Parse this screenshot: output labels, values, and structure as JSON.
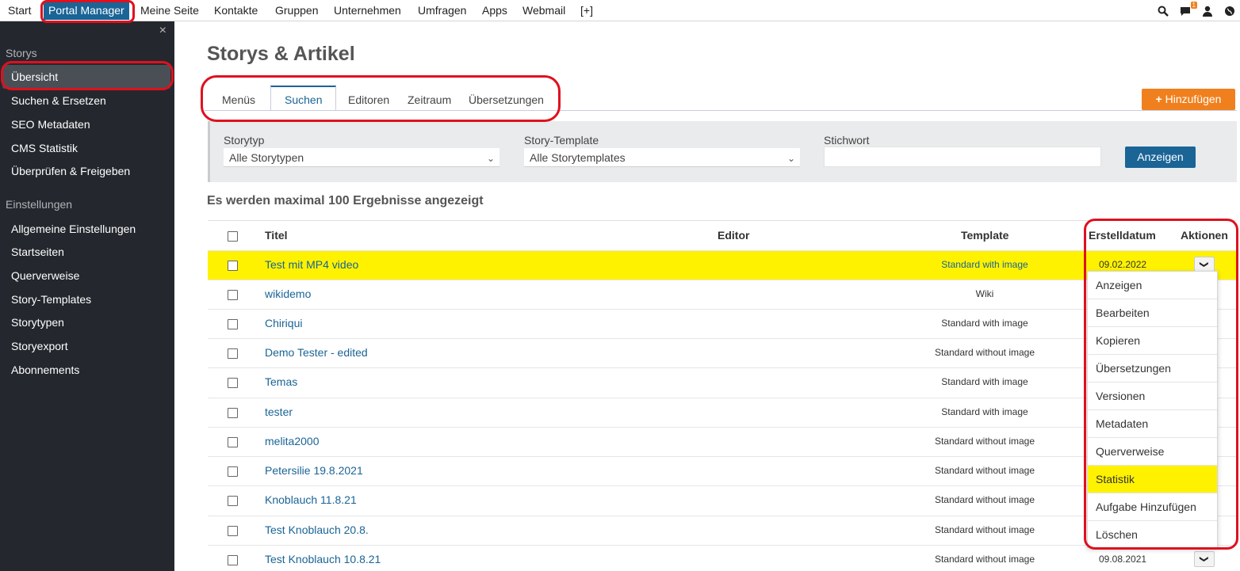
{
  "topnav": {
    "items": [
      "Start",
      "Portal Manager",
      "Meine Seite",
      "Kontakte",
      "Gruppen",
      "Unternehmen",
      "Umfragen",
      "Apps",
      "Webmail",
      "[+]"
    ],
    "active": "Portal Manager",
    "notification_count": "1",
    "icons": [
      "search-icon",
      "chat-icon",
      "user-icon",
      "globe-icon"
    ]
  },
  "sidebar": {
    "close": "×",
    "section1": "Storys",
    "storys": [
      "Übersicht",
      "Suchen & Ersetzen",
      "SEO Metadaten",
      "CMS Statistik",
      "Überprüfen & Freigeben"
    ],
    "section2": "Einstellungen",
    "settings": [
      "Allgemeine Einstellungen",
      "Startseiten",
      "Querverweise",
      "Story-Templates",
      "Storytypen",
      "Storyexport",
      "Abonnements"
    ]
  },
  "main": {
    "title": "Storys & Artikel",
    "tabs": [
      "Menüs",
      "Suchen",
      "Editoren",
      "Zeitraum",
      "Übersetzungen"
    ],
    "active_tab": "Suchen",
    "add_button": "Hinzufügen",
    "filter": {
      "storytyp_label": "Storytyp",
      "storytyp_value": "Alle Storytypen",
      "template_label": "Story-Template",
      "template_value": "Alle Storytemplates",
      "keyword_label": "Stichwort",
      "keyword_value": "",
      "show_button": "Anzeigen"
    },
    "results_info": "Es werden maximal 100 Ergebnisse angezeigt",
    "table": {
      "headers": {
        "title": "Titel",
        "editor": "Editor",
        "template": "Template",
        "created": "Erstelldatum",
        "actions": "Aktionen"
      },
      "rows": [
        {
          "title": "Test mit MP4 video",
          "template": "Standard with image",
          "date": "09.02.2022",
          "highlight": true
        },
        {
          "title": "wikidemo",
          "template": "Wiki",
          "date": ""
        },
        {
          "title": "Chiriqui",
          "template": "Standard with image",
          "date": ""
        },
        {
          "title": "Demo Tester - edited",
          "template": "Standard without image",
          "date": ""
        },
        {
          "title": "Temas",
          "template": "Standard with image",
          "date": ""
        },
        {
          "title": "tester",
          "template": "Standard with image",
          "date": ""
        },
        {
          "title": "melita2000",
          "template": "Standard without image",
          "date": ""
        },
        {
          "title": "Petersilie 19.8.2021",
          "template": "Standard without image",
          "date": ""
        },
        {
          "title": "Knoblauch 11.8.21",
          "template": "Standard without image",
          "date": ""
        },
        {
          "title": "Test Knoblauch 20.8.",
          "template": "Standard without image",
          "date": ""
        },
        {
          "title": "Test Knoblauch 10.8.21",
          "template": "Standard without image",
          "date": "09.08.2021"
        }
      ]
    },
    "actions_menu": [
      "Anzeigen",
      "Bearbeiten",
      "Kopieren",
      "Übersetzungen",
      "Versionen",
      "Metadaten",
      "Querverweise",
      "Statistik",
      "Aufgabe Hinzufügen",
      "Löschen"
    ],
    "actions_menu_highlight": "Statistik"
  },
  "colors": {
    "accent": "#1a6496",
    "add_button": "#f0801e",
    "highlight": "#fff200",
    "annotation": "#e0101e",
    "sidebar": "#24282e"
  }
}
